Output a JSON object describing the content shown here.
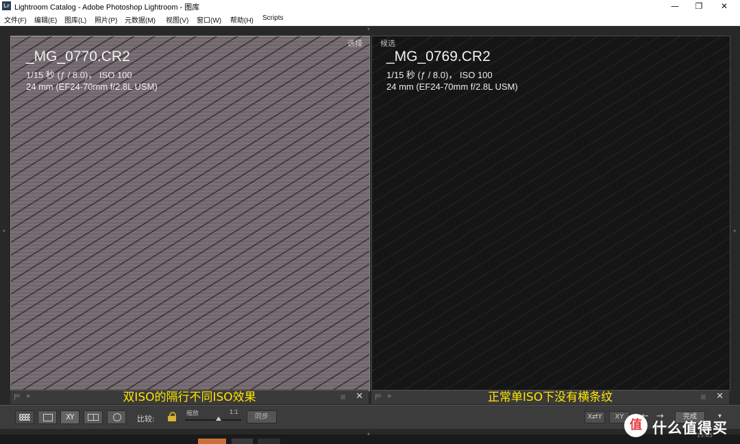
{
  "window": {
    "app_icon": "Lr",
    "title": "Lightroom Catalog - Adobe Photoshop Lightroom - 图库",
    "minimize": "—",
    "maximize": "❐",
    "close": "✕"
  },
  "menu": [
    "文件(F)",
    "编辑(E)",
    "图库(L)",
    "照片(P)",
    "元数据(M)",
    "视图(V)",
    "窗口(W)",
    "帮助(H)",
    "Scripts"
  ],
  "left_panel": {
    "corner_label": "选择",
    "filename": "_MG_0770.CR2",
    "exposure": "1/15 秒 (ƒ / 8.0)， ISO 100",
    "lens": "24 mm (EF24-70mm f/2.8L USM)",
    "caption": "双ISO的隔行不同ISO效果",
    "close": "✕"
  },
  "right_panel": {
    "corner_label": "候选",
    "filename": "_MG_0769.CR2",
    "exposure": "1/15 秒 (ƒ / 8.0)， ISO 100",
    "lens": "24 mm (EF24-70mm f/2.8L USM)",
    "caption": "正常单ISO下没有横条纹",
    "close": "✕"
  },
  "toolbar": {
    "compare_view_label": "XY",
    "compare_label": "比较:",
    "zoom_label": "缩放",
    "zoom_value": "1:1",
    "sync_label": "同步",
    "swap_label": "X⇄Y",
    "make_select_label": "XY",
    "prev_arrow": "←",
    "next_arrow": "→",
    "done_label": "完成",
    "dropdown_arrow": "▾"
  },
  "filmstrip": {
    "time": "15:05"
  },
  "watermark": {
    "logo": "值",
    "text": "什么值得买"
  },
  "colors": {
    "caption": "#ffe600",
    "lock": "#d8b23a",
    "background": "#282828"
  }
}
